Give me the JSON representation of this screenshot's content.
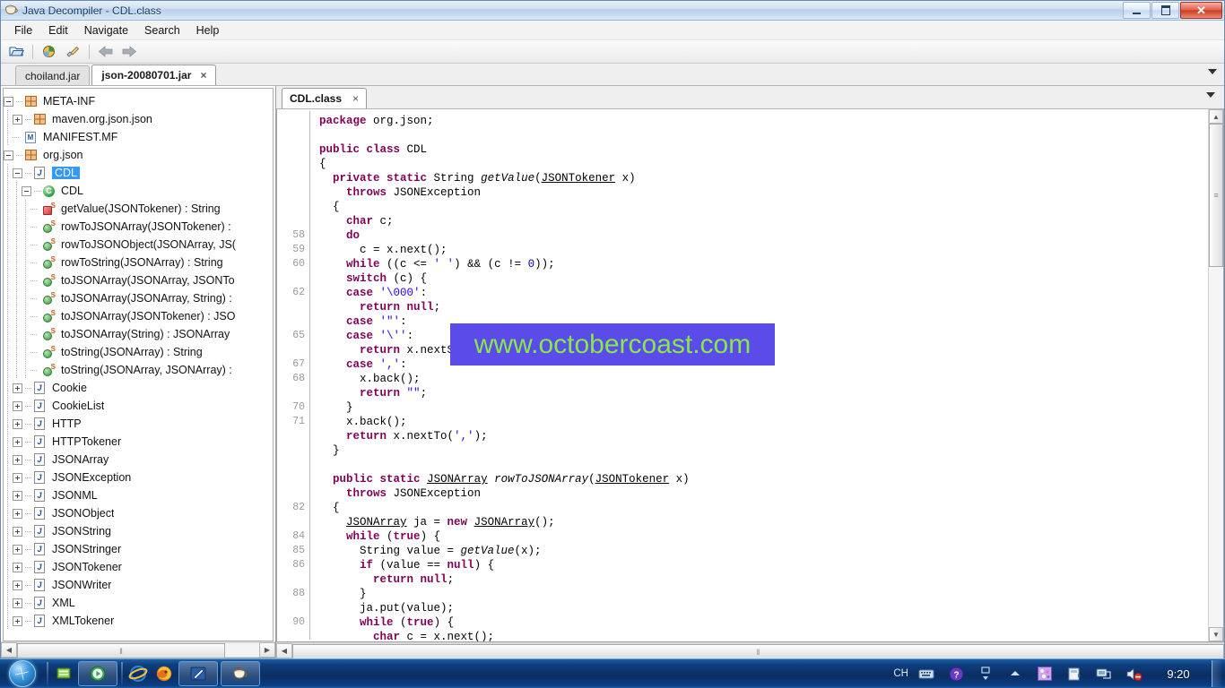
{
  "window": {
    "title": "Java Decompiler - CDL.class",
    "app_icon": "coffee-cup-icon",
    "buttons": {
      "minimize": "minimize-button",
      "restore": "restore-button",
      "close": "close-button"
    }
  },
  "menu": {
    "items": [
      "File",
      "Edit",
      "Navigate",
      "Search",
      "Help"
    ]
  },
  "toolbar": {
    "items": [
      {
        "name": "open-file-icon"
      },
      {
        "name": "open-type-icon"
      },
      {
        "name": "save-all-icon"
      },
      {
        "name": "navigate-back-icon"
      },
      {
        "name": "navigate-forward-icon"
      }
    ]
  },
  "jar_tabs": {
    "tabs": [
      {
        "label": "choiland.jar",
        "active": false,
        "closable": false
      },
      {
        "label": "json-20080701.jar",
        "active": true,
        "closable": true,
        "close_glyph": "×"
      }
    ],
    "overflow_glyph": "▼"
  },
  "tree": {
    "nodes": [
      {
        "indent": 0,
        "expander": "minus",
        "icon": "package-icon",
        "label": "META-INF",
        "selected": false
      },
      {
        "indent": 1,
        "expander": "plus",
        "icon": "package-icon",
        "label": "maven.org.json.json",
        "selected": false
      },
      {
        "indent": 1,
        "expander": "none",
        "icon": "manifest-icon",
        "label": "MANIFEST.MF",
        "selected": false
      },
      {
        "indent": 0,
        "expander": "minus",
        "icon": "package-icon",
        "label": "org.json",
        "selected": false
      },
      {
        "indent": 1,
        "expander": "minus",
        "icon": "java-class-icon",
        "label": "CDL",
        "selected": true
      },
      {
        "indent": 2,
        "expander": "minus",
        "icon": "class-icon",
        "label": "CDL",
        "selected": false
      },
      {
        "indent": 3,
        "expander": "none",
        "icon": "method-private-static-icon",
        "label": "getValue(JSONTokener) : String",
        "selected": false
      },
      {
        "indent": 3,
        "expander": "none",
        "icon": "method-public-static-icon",
        "label": "rowToJSONArray(JSONTokener) :",
        "selected": false
      },
      {
        "indent": 3,
        "expander": "none",
        "icon": "method-public-static-icon",
        "label": "rowToJSONObject(JSONArray, JS(",
        "selected": false
      },
      {
        "indent": 3,
        "expander": "none",
        "icon": "method-public-static-icon",
        "label": "rowToString(JSONArray) : String",
        "selected": false
      },
      {
        "indent": 3,
        "expander": "none",
        "icon": "method-public-static-icon",
        "label": "toJSONArray(JSONArray, JSONTo",
        "selected": false
      },
      {
        "indent": 3,
        "expander": "none",
        "icon": "method-public-static-icon",
        "label": "toJSONArray(JSONArray, String) :",
        "selected": false
      },
      {
        "indent": 3,
        "expander": "none",
        "icon": "method-public-static-icon",
        "label": "toJSONArray(JSONTokener) : JSO",
        "selected": false
      },
      {
        "indent": 3,
        "expander": "none",
        "icon": "method-public-static-icon",
        "label": "toJSONArray(String) : JSONArray",
        "selected": false
      },
      {
        "indent": 3,
        "expander": "none",
        "icon": "method-public-static-icon",
        "label": "toString(JSONArray) : String",
        "selected": false
      },
      {
        "indent": 3,
        "expander": "none",
        "icon": "method-public-static-icon",
        "label": "toString(JSONArray, JSONArray) :",
        "selected": false
      },
      {
        "indent": 1,
        "expander": "plus",
        "icon": "java-class-icon",
        "label": "Cookie",
        "selected": false
      },
      {
        "indent": 1,
        "expander": "plus",
        "icon": "java-class-icon",
        "label": "CookieList",
        "selected": false
      },
      {
        "indent": 1,
        "expander": "plus",
        "icon": "java-class-icon",
        "label": "HTTP",
        "selected": false
      },
      {
        "indent": 1,
        "expander": "plus",
        "icon": "java-class-icon",
        "label": "HTTPTokener",
        "selected": false
      },
      {
        "indent": 1,
        "expander": "plus",
        "icon": "java-class-icon",
        "label": "JSONArray",
        "selected": false
      },
      {
        "indent": 1,
        "expander": "plus",
        "icon": "java-class-icon",
        "label": "JSONException",
        "selected": false
      },
      {
        "indent": 1,
        "expander": "plus",
        "icon": "java-class-icon",
        "label": "JSONML",
        "selected": false
      },
      {
        "indent": 1,
        "expander": "plus",
        "icon": "java-class-icon",
        "label": "JSONObject",
        "selected": false
      },
      {
        "indent": 1,
        "expander": "plus",
        "icon": "java-class-icon",
        "label": "JSONString",
        "selected": false
      },
      {
        "indent": 1,
        "expander": "plus",
        "icon": "java-class-icon",
        "label": "JSONStringer",
        "selected": false
      },
      {
        "indent": 1,
        "expander": "plus",
        "icon": "java-class-icon",
        "label": "JSONTokener",
        "selected": false
      },
      {
        "indent": 1,
        "expander": "plus",
        "icon": "java-class-icon",
        "label": "JSONWriter",
        "selected": false
      },
      {
        "indent": 1,
        "expander": "plus",
        "icon": "java-class-icon",
        "label": "XML",
        "selected": false
      },
      {
        "indent": 1,
        "expander": "plus",
        "icon": "java-class-icon",
        "label": "XMLTokener",
        "selected": false
      }
    ],
    "hscroll": {
      "left_glyph": "◀",
      "right_glyph": "▶",
      "grip": "‖"
    }
  },
  "editor": {
    "tab": {
      "label": "CDL.class",
      "close_glyph": "×"
    },
    "overflow_glyph": "▼",
    "line_numbers": [
      "",
      "",
      "",
      "",
      "",
      "",
      "",
      "",
      "58",
      "59",
      "60",
      "",
      "62",
      "",
      "",
      "65",
      "",
      "67",
      "68",
      "",
      "70",
      "71",
      "",
      "",
      "",
      "",
      "",
      "82",
      "",
      "84",
      "85",
      "86",
      "",
      "88",
      "",
      "90"
    ],
    "lines": [
      [
        {
          "t": "kw",
          "v": "package"
        },
        {
          "t": "plain",
          "v": " org.json;"
        }
      ],
      [],
      [
        {
          "t": "kw",
          "v": "public class"
        },
        {
          "t": "plain",
          "v": " CDL"
        }
      ],
      [
        {
          "t": "plain",
          "v": "{"
        }
      ],
      [
        {
          "t": "plain",
          "v": "  "
        },
        {
          "t": "kw",
          "v": "private static"
        },
        {
          "t": "plain",
          "v": " String "
        },
        {
          "t": "mth",
          "v": "getValue"
        },
        {
          "t": "plain",
          "v": "("
        },
        {
          "t": "typ",
          "v": "JSONTokener"
        },
        {
          "t": "plain",
          "v": " x)"
        }
      ],
      [
        {
          "t": "plain",
          "v": "    "
        },
        {
          "t": "kw",
          "v": "throws"
        },
        {
          "t": "plain",
          "v": " JSONException"
        }
      ],
      [
        {
          "t": "plain",
          "v": "  {"
        }
      ],
      [
        {
          "t": "plain",
          "v": "    "
        },
        {
          "t": "kw",
          "v": "char"
        },
        {
          "t": "plain",
          "v": " c;"
        }
      ],
      [
        {
          "t": "plain",
          "v": "    "
        },
        {
          "t": "kw",
          "v": "do"
        }
      ],
      [
        {
          "t": "plain",
          "v": "      c = x.next();"
        }
      ],
      [
        {
          "t": "plain",
          "v": "    "
        },
        {
          "t": "kw",
          "v": "while"
        },
        {
          "t": "plain",
          "v": " ((c <= "
        },
        {
          "t": "str",
          "v": "' '"
        },
        {
          "t": "plain",
          "v": ") && (c != "
        },
        {
          "t": "num",
          "v": "0"
        },
        {
          "t": "plain",
          "v": "));"
        }
      ],
      [
        {
          "t": "plain",
          "v": "    "
        },
        {
          "t": "kw",
          "v": "switch"
        },
        {
          "t": "plain",
          "v": " (c) {"
        }
      ],
      [
        {
          "t": "plain",
          "v": "    "
        },
        {
          "t": "kw",
          "v": "case"
        },
        {
          "t": "plain",
          "v": " "
        },
        {
          "t": "str",
          "v": "'\\000'"
        },
        {
          "t": "plain",
          "v": ":"
        }
      ],
      [
        {
          "t": "plain",
          "v": "      "
        },
        {
          "t": "kw",
          "v": "return"
        },
        {
          "t": "plain",
          "v": " "
        },
        {
          "t": "kw",
          "v": "null"
        },
        {
          "t": "plain",
          "v": ";"
        }
      ],
      [
        {
          "t": "plain",
          "v": "    "
        },
        {
          "t": "kw",
          "v": "case"
        },
        {
          "t": "plain",
          "v": " "
        },
        {
          "t": "str",
          "v": "'\"'"
        },
        {
          "t": "plain",
          "v": ":"
        }
      ],
      [
        {
          "t": "plain",
          "v": "    "
        },
        {
          "t": "kw",
          "v": "case"
        },
        {
          "t": "plain",
          "v": " "
        },
        {
          "t": "str",
          "v": "'\\''"
        },
        {
          "t": "plain",
          "v": ":"
        }
      ],
      [
        {
          "t": "plain",
          "v": "      "
        },
        {
          "t": "kw",
          "v": "return"
        },
        {
          "t": "plain",
          "v": " x.nextString(c);"
        }
      ],
      [
        {
          "t": "plain",
          "v": "    "
        },
        {
          "t": "kw",
          "v": "case"
        },
        {
          "t": "plain",
          "v": " "
        },
        {
          "t": "str",
          "v": "','"
        },
        {
          "t": "plain",
          "v": ":"
        }
      ],
      [
        {
          "t": "plain",
          "v": "      x.back();"
        }
      ],
      [
        {
          "t": "plain",
          "v": "      "
        },
        {
          "t": "kw",
          "v": "return"
        },
        {
          "t": "plain",
          "v": " "
        },
        {
          "t": "str",
          "v": "\"\""
        },
        {
          "t": "plain",
          "v": ";"
        }
      ],
      [
        {
          "t": "plain",
          "v": "    }"
        }
      ],
      [
        {
          "t": "plain",
          "v": "    x.back();"
        }
      ],
      [
        {
          "t": "plain",
          "v": "    "
        },
        {
          "t": "kw",
          "v": "return"
        },
        {
          "t": "plain",
          "v": " x.nextTo("
        },
        {
          "t": "str",
          "v": "','"
        },
        {
          "t": "plain",
          "v": ");"
        }
      ],
      [
        {
          "t": "plain",
          "v": "  }"
        }
      ],
      [],
      [
        {
          "t": "plain",
          "v": "  "
        },
        {
          "t": "kw",
          "v": "public static"
        },
        {
          "t": "plain",
          "v": " "
        },
        {
          "t": "typ",
          "v": "JSONArray"
        },
        {
          "t": "plain",
          "v": " "
        },
        {
          "t": "mth",
          "v": "rowToJSONArray"
        },
        {
          "t": "plain",
          "v": "("
        },
        {
          "t": "typ",
          "v": "JSONTokener"
        },
        {
          "t": "plain",
          "v": " x)"
        }
      ],
      [
        {
          "t": "plain",
          "v": "    "
        },
        {
          "t": "kw",
          "v": "throws"
        },
        {
          "t": "plain",
          "v": " JSONException"
        }
      ],
      [
        {
          "t": "plain",
          "v": "  {"
        }
      ],
      [
        {
          "t": "plain",
          "v": "    "
        },
        {
          "t": "typ",
          "v": "JSONArray"
        },
        {
          "t": "plain",
          "v": " ja = "
        },
        {
          "t": "kw",
          "v": "new"
        },
        {
          "t": "plain",
          "v": " "
        },
        {
          "t": "typ",
          "v": "JSONArray"
        },
        {
          "t": "plain",
          "v": "();"
        }
      ],
      [
        {
          "t": "plain",
          "v": "    "
        },
        {
          "t": "kw",
          "v": "while"
        },
        {
          "t": "plain",
          "v": " ("
        },
        {
          "t": "kw",
          "v": "true"
        },
        {
          "t": "plain",
          "v": ") {"
        }
      ],
      [
        {
          "t": "plain",
          "v": "      String value = "
        },
        {
          "t": "mth",
          "v": "getValue"
        },
        {
          "t": "plain",
          "v": "(x);"
        }
      ],
      [
        {
          "t": "plain",
          "v": "      "
        },
        {
          "t": "kw",
          "v": "if"
        },
        {
          "t": "plain",
          "v": " (value == "
        },
        {
          "t": "kw",
          "v": "null"
        },
        {
          "t": "plain",
          "v": ") {"
        }
      ],
      [
        {
          "t": "plain",
          "v": "        "
        },
        {
          "t": "kw",
          "v": "return"
        },
        {
          "t": "plain",
          "v": " "
        },
        {
          "t": "kw",
          "v": "null"
        },
        {
          "t": "plain",
          "v": ";"
        }
      ],
      [
        {
          "t": "plain",
          "v": "      }"
        }
      ],
      [
        {
          "t": "plain",
          "v": "      ja.put(value);"
        }
      ],
      [
        {
          "t": "plain",
          "v": "      "
        },
        {
          "t": "kw",
          "v": "while"
        },
        {
          "t": "plain",
          "v": " ("
        },
        {
          "t": "kw",
          "v": "true"
        },
        {
          "t": "plain",
          "v": ") {"
        }
      ],
      [
        {
          "t": "plain",
          "v": "        "
        },
        {
          "t": "kw",
          "v": "char"
        },
        {
          "t": "plain",
          "v": " c = x.next();"
        }
      ]
    ],
    "vscroll": {
      "up_glyph": "▲",
      "down_glyph": "▼",
      "grip": "≡"
    },
    "hscroll": {
      "left_glyph": "◀",
      "grip": "‖"
    }
  },
  "watermark": {
    "text": "www.octobercoast.com",
    "text_color": "#86e84a",
    "background_color": "#5b4be8"
  },
  "taskbar": {
    "start_label": "start-orb",
    "quick_launch": [
      {
        "name": "show-desktop-icon"
      },
      {
        "name": "media-player-icon"
      }
    ],
    "tasks": [
      {
        "name": "internet-explorer-icon"
      },
      {
        "name": "firefox-icon"
      },
      {
        "name": "editor-icon"
      },
      {
        "name": "java-decompiler-icon"
      }
    ],
    "tray": {
      "ime_label": "CH",
      "icons": [
        "keyboard-icon",
        "help-icon",
        "language-bar-restore-icon",
        "show-hidden-icons-icon",
        "network-activity-icon",
        "removable-media-icon",
        "network-icon",
        "volume-muted-icon"
      ],
      "clock": "9:20"
    }
  }
}
